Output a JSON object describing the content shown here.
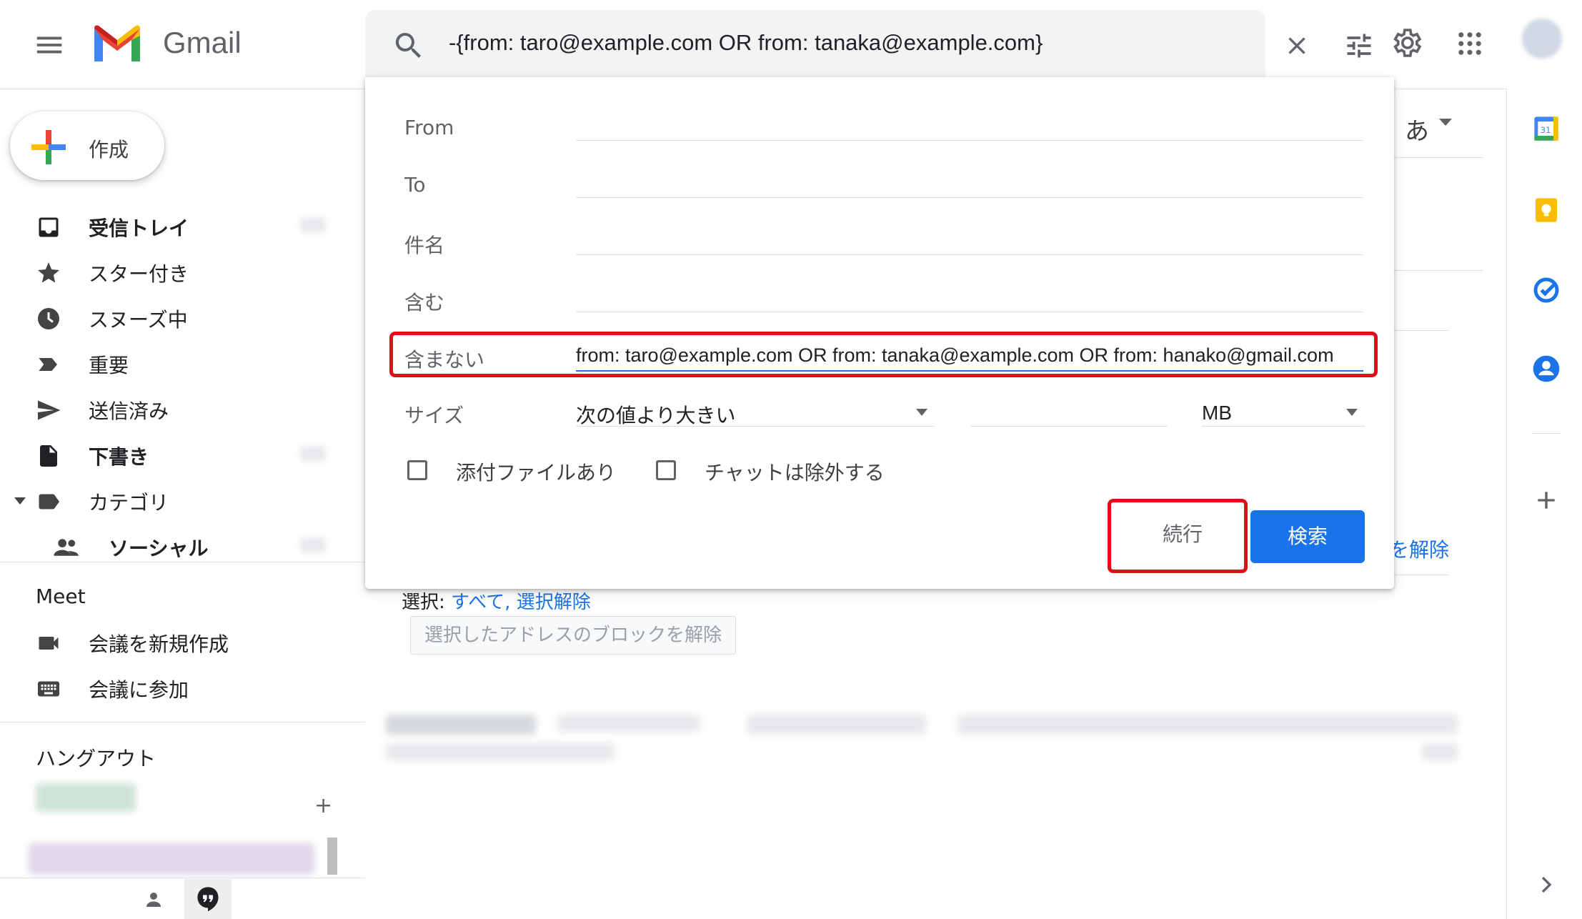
{
  "app": {
    "logo_text": "Gmail"
  },
  "search": {
    "query": "-{from: taro@example.com OR from: tanaka@example.com}"
  },
  "compose": {
    "label": "作成"
  },
  "nav": {
    "items": [
      {
        "label": "受信トレイ",
        "icon": "inbox-icon",
        "bold": true
      },
      {
        "label": "スター付き",
        "icon": "star-icon",
        "bold": false
      },
      {
        "label": "スヌーズ中",
        "icon": "snooze-clock-icon",
        "bold": false
      },
      {
        "label": "重要",
        "icon": "important-label-icon",
        "bold": false
      },
      {
        "label": "送信済み",
        "icon": "send-icon",
        "bold": false
      },
      {
        "label": "下書き",
        "icon": "draft-file-icon",
        "bold": true
      },
      {
        "label": "カテゴリ",
        "icon": "label-icon",
        "bold": false
      },
      {
        "label": "ソーシャル",
        "icon": "people-icon",
        "bold": true
      }
    ]
  },
  "meet": {
    "title": "Meet",
    "new_meeting": "会議を新規作成",
    "join_meeting": "会議に参加"
  },
  "hangouts": {
    "title": "ハングアウト"
  },
  "advanced_search": {
    "from_label": "From",
    "to_label": "To",
    "subject_label": "件名",
    "has_words_label": "含む",
    "exclude_label": "含まない",
    "exclude_value": "from: taro@example.com OR from: tanaka@example.com OR from: hanako@gmail.com",
    "size_label": "サイズ",
    "size_operator": "次の値より大きい",
    "size_unit": "MB",
    "has_attachment_label": "添付ファイルあり",
    "exclude_chats_label": "チャットは除外する",
    "continue_label": "続行",
    "search_label": "検索"
  },
  "behind": {
    "input_tool": "あ",
    "link_fragment": "を解除",
    "select_prefix": "選択: ",
    "select_all": "すべて, 選択解除",
    "unblock_button": "選択したアドレスのブロックを解除"
  },
  "colors": {
    "accent_blue": "#1a73e8",
    "highlight_red": "#e30d17",
    "search_bar_bg": "#f1f3f4"
  }
}
